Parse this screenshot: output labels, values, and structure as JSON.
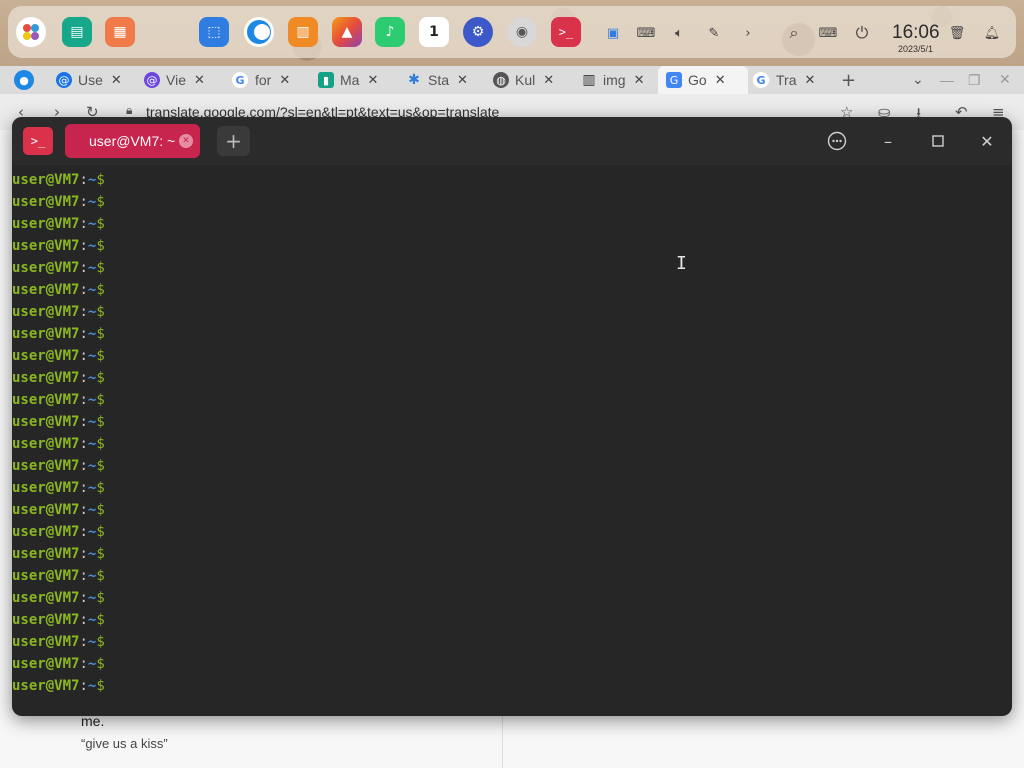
{
  "dock": {
    "apps": [
      {
        "name": "launcher",
        "icon": "launcher-icon"
      },
      {
        "name": "file-manager",
        "icon": "folder-icon"
      },
      {
        "name": "multitask-view",
        "icon": "grid-icon"
      },
      {
        "name": "app-store",
        "icon": "store-icon"
      },
      {
        "name": "browser",
        "icon": "browser-icon"
      },
      {
        "name": "box-app",
        "icon": "box-icon"
      },
      {
        "name": "photos",
        "icon": "photos-icon"
      },
      {
        "name": "music",
        "icon": "music-icon"
      },
      {
        "name": "calendar",
        "icon": "calendar-icon",
        "label": "1"
      },
      {
        "name": "settings",
        "icon": "gear-icon"
      },
      {
        "name": "disk-utility",
        "icon": "disk-icon"
      },
      {
        "name": "terminal",
        "icon": "terminal-icon"
      }
    ],
    "tray": [
      "screenshot-icon",
      "keyboard-icon",
      "volume-icon",
      "tool-icon",
      "chevron-right-icon",
      "search-icon",
      "keyboard-layout-icon",
      "power-icon"
    ],
    "clock": {
      "time": "16:06",
      "date": "2023/5/1"
    }
  },
  "browser": {
    "tabs": [
      {
        "label": "Use",
        "icon": "spiral-icon",
        "color": "#1a73e8"
      },
      {
        "label": "Vie",
        "icon": "at-icon",
        "color": "#6b46e0"
      },
      {
        "label": "for",
        "icon": "google-icon",
        "color": "#4285f4"
      },
      {
        "label": "Ma",
        "icon": "chart-icon",
        "color": "#16a085"
      },
      {
        "label": "Sta",
        "icon": "star-icon",
        "color": "#2b7fd9"
      },
      {
        "label": "Kul",
        "icon": "globe-icon",
        "color": "#555555"
      },
      {
        "label": "img",
        "icon": "archive-icon",
        "color": "#333333"
      },
      {
        "label": "Go",
        "icon": "translate-icon",
        "color": "#4285f4",
        "active": true
      },
      {
        "label": "Tra",
        "icon": "google-icon",
        "color": "#4285f4"
      }
    ],
    "url": "translate.google.com/?sl=en&tl=pt&text=us&op=translate"
  },
  "page": {
    "text1": "me.",
    "text2": "“give us a kiss”"
  },
  "terminal": {
    "tab_title": "user@VM7: ~",
    "prompt": {
      "user": "user@VM7",
      "sep": ":",
      "path": "~",
      "symbol": "$"
    },
    "prompt_count": 24,
    "colors": {
      "user": "#8ab622",
      "path": "#4a90d9",
      "background": "#262626",
      "tab": "#c7244e"
    }
  }
}
